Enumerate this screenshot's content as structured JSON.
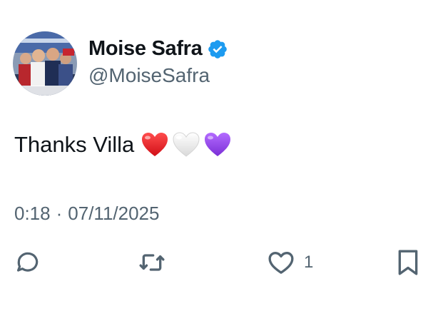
{
  "author": {
    "display_name": "Moise Safra",
    "handle": "@MoiseSafra",
    "verified": true,
    "verified_color": "#1d9bf0"
  },
  "tweet": {
    "text": "Thanks Villa",
    "emojis": [
      "red-heart",
      "white-heart",
      "purple-heart"
    ],
    "time": "0:18",
    "separator": "·",
    "date": "07/11/2025"
  },
  "actions": {
    "reply_icon": "reply-icon",
    "retweet_icon": "retweet-icon",
    "like_icon": "heart-icon",
    "like_count": "1",
    "bookmark_icon": "bookmark-icon"
  }
}
